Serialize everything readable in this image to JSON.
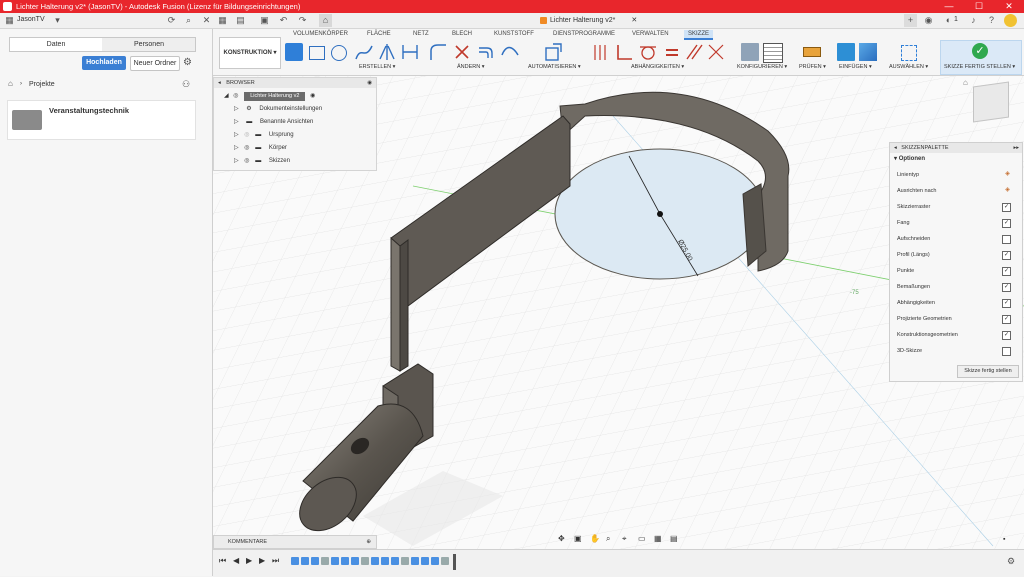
{
  "window": {
    "title": "Lichter Halterung v2* (JasonTV) - Autodesk Fusion (Lizenz für Bildungseinrichtungen)"
  },
  "appbar": {
    "user": "JasonTV",
    "doc_title": "Lichter Halterung v2*",
    "notif_count": "1"
  },
  "left": {
    "tabs": [
      "Daten",
      "Personen"
    ],
    "upload": "Hochladen",
    "new_folder": "Neuer Ordner",
    "breadcrumb": "Projekte",
    "project": "Veranstaltungstechnik"
  },
  "ribbon": {
    "tabs": [
      "VOLUMENKÖRPER",
      "FLÄCHE",
      "NETZ",
      "BLECH",
      "KUNSTSTOFF",
      "DIENSTPROGRAMME",
      "VERWALTEN",
      "SKIZZE"
    ],
    "workspace": "KONSTRUKTION",
    "groups": [
      "ERSTELLEN",
      "ÄNDERN",
      "AUTOMATISIEREN",
      "ABHÄNGIGKEITEN",
      "KONFIGURIEREN",
      "PRÜFEN",
      "EINFÜGEN",
      "AUSWÄHLEN"
    ],
    "finish": "SKIZZE FERTIG STELLEN"
  },
  "browser": {
    "title": "BROWSER",
    "root": "Lichter Halterung v2",
    "items": [
      "Dokumenteinstellungen",
      "Benannte Ansichten",
      "Ursprung",
      "Körper",
      "Skizzen"
    ]
  },
  "palette": {
    "title": "SKIZZENPALETTE",
    "section": "Optionen",
    "rows": [
      {
        "label": "Linientyp",
        "type": "icon"
      },
      {
        "label": "Ausrichten nach",
        "type": "icon"
      },
      {
        "label": "Skizzierraster",
        "checked": true
      },
      {
        "label": "Fang",
        "checked": true
      },
      {
        "label": "Aufschneiden",
        "checked": false
      },
      {
        "label": "Profil (Längs)",
        "checked": true
      },
      {
        "label": "Punkte",
        "checked": true
      },
      {
        "label": "Bemaßungen",
        "checked": true
      },
      {
        "label": "Abhängigkeiten",
        "checked": true
      },
      {
        "label": "Projizierte Geometrien",
        "checked": true
      },
      {
        "label": "Konstruktionsgeometrien",
        "checked": true
      },
      {
        "label": "3D-Skizze",
        "checked": false
      }
    ],
    "button": "Skizze fertig stellen"
  },
  "viewport": {
    "dimension": "Ø25.00",
    "axis_label": "-75"
  },
  "comments": {
    "title": "KOMMENTARE"
  },
  "colors": {
    "titlebar": "#e8262c",
    "accent": "#3b7fd4",
    "active_tab": "#dbe9f7",
    "body": "#6f6a63"
  }
}
